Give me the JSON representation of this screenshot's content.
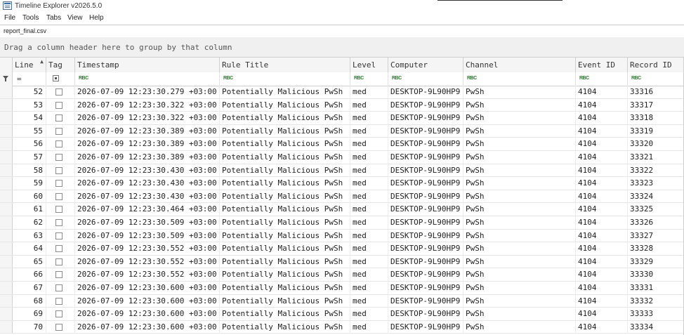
{
  "window": {
    "title": "Timeline Explorer v2026.5.0"
  },
  "menu": {
    "items": [
      "File",
      "Tools",
      "Tabs",
      "View",
      "Help"
    ]
  },
  "file_tab": {
    "label": "report_final.csv"
  },
  "group_panel": {
    "hint": "Drag a column header here to group by that column"
  },
  "columns": [
    {
      "key": "line",
      "label": "Line"
    },
    {
      "key": "tag",
      "label": "Tag"
    },
    {
      "key": "timestamp",
      "label": "Timestamp"
    },
    {
      "key": "rule_title",
      "label": "Rule Title"
    },
    {
      "key": "level",
      "label": "Level"
    },
    {
      "key": "computer",
      "label": "Computer"
    },
    {
      "key": "channel",
      "label": "Channel"
    },
    {
      "key": "event_id",
      "label": "Event ID"
    },
    {
      "key": "record_id",
      "label": "Record ID"
    }
  ],
  "filter_row": {
    "line_operator": "=",
    "text_filter_icon": "RBC"
  },
  "rows": [
    {
      "line": "52",
      "timestamp": "2026-07-09 12:23:30.279 +03:00",
      "rule_title": "Potentially Malicious PwSh",
      "level": "med",
      "computer": "DESKTOP-9L90HP9",
      "channel": "PwSh",
      "event_id": "4104",
      "record_id": "33316"
    },
    {
      "line": "53",
      "timestamp": "2026-07-09 12:23:30.322 +03:00",
      "rule_title": "Potentially Malicious PwSh",
      "level": "med",
      "computer": "DESKTOP-9L90HP9",
      "channel": "PwSh",
      "event_id": "4104",
      "record_id": "33317"
    },
    {
      "line": "54",
      "timestamp": "2026-07-09 12:23:30.322 +03:00",
      "rule_title": "Potentially Malicious PwSh",
      "level": "med",
      "computer": "DESKTOP-9L90HP9",
      "channel": "PwSh",
      "event_id": "4104",
      "record_id": "33318"
    },
    {
      "line": "55",
      "timestamp": "2026-07-09 12:23:30.389 +03:00",
      "rule_title": "Potentially Malicious PwSh",
      "level": "med",
      "computer": "DESKTOP-9L90HP9",
      "channel": "PwSh",
      "event_id": "4104",
      "record_id": "33319"
    },
    {
      "line": "56",
      "timestamp": "2026-07-09 12:23:30.389 +03:00",
      "rule_title": "Potentially Malicious PwSh",
      "level": "med",
      "computer": "DESKTOP-9L90HP9",
      "channel": "PwSh",
      "event_id": "4104",
      "record_id": "33320"
    },
    {
      "line": "57",
      "timestamp": "2026-07-09 12:23:30.389 +03:00",
      "rule_title": "Potentially Malicious PwSh",
      "level": "med",
      "computer": "DESKTOP-9L90HP9",
      "channel": "PwSh",
      "event_id": "4104",
      "record_id": "33321"
    },
    {
      "line": "58",
      "timestamp": "2026-07-09 12:23:30.430 +03:00",
      "rule_title": "Potentially Malicious PwSh",
      "level": "med",
      "computer": "DESKTOP-9L90HP9",
      "channel": "PwSh",
      "event_id": "4104",
      "record_id": "33322"
    },
    {
      "line": "59",
      "timestamp": "2026-07-09 12:23:30.430 +03:00",
      "rule_title": "Potentially Malicious PwSh",
      "level": "med",
      "computer": "DESKTOP-9L90HP9",
      "channel": "PwSh",
      "event_id": "4104",
      "record_id": "33323"
    },
    {
      "line": "60",
      "timestamp": "2026-07-09 12:23:30.430 +03:00",
      "rule_title": "Potentially Malicious PwSh",
      "level": "med",
      "computer": "DESKTOP-9L90HP9",
      "channel": "PwSh",
      "event_id": "4104",
      "record_id": "33324"
    },
    {
      "line": "61",
      "timestamp": "2026-07-09 12:23:30.464 +03:00",
      "rule_title": "Potentially Malicious PwSh",
      "level": "med",
      "computer": "DESKTOP-9L90HP9",
      "channel": "PwSh",
      "event_id": "4104",
      "record_id": "33325"
    },
    {
      "line": "62",
      "timestamp": "2026-07-09 12:23:30.509 +03:00",
      "rule_title": "Potentially Malicious PwSh",
      "level": "med",
      "computer": "DESKTOP-9L90HP9",
      "channel": "PwSh",
      "event_id": "4104",
      "record_id": "33326"
    },
    {
      "line": "63",
      "timestamp": "2026-07-09 12:23:30.509 +03:00",
      "rule_title": "Potentially Malicious PwSh",
      "level": "med",
      "computer": "DESKTOP-9L90HP9",
      "channel": "PwSh",
      "event_id": "4104",
      "record_id": "33327"
    },
    {
      "line": "64",
      "timestamp": "2026-07-09 12:23:30.552 +03:00",
      "rule_title": "Potentially Malicious PwSh",
      "level": "med",
      "computer": "DESKTOP-9L90HP9",
      "channel": "PwSh",
      "event_id": "4104",
      "record_id": "33328"
    },
    {
      "line": "65",
      "timestamp": "2026-07-09 12:23:30.552 +03:00",
      "rule_title": "Potentially Malicious PwSh",
      "level": "med",
      "computer": "DESKTOP-9L90HP9",
      "channel": "PwSh",
      "event_id": "4104",
      "record_id": "33329"
    },
    {
      "line": "66",
      "timestamp": "2026-07-09 12:23:30.552 +03:00",
      "rule_title": "Potentially Malicious PwSh",
      "level": "med",
      "computer": "DESKTOP-9L90HP9",
      "channel": "PwSh",
      "event_id": "4104",
      "record_id": "33330"
    },
    {
      "line": "67",
      "timestamp": "2026-07-09 12:23:30.600 +03:00",
      "rule_title": "Potentially Malicious PwSh",
      "level": "med",
      "computer": "DESKTOP-9L90HP9",
      "channel": "PwSh",
      "event_id": "4104",
      "record_id": "33331"
    },
    {
      "line": "68",
      "timestamp": "2026-07-09 12:23:30.600 +03:00",
      "rule_title": "Potentially Malicious PwSh",
      "level": "med",
      "computer": "DESKTOP-9L90HP9",
      "channel": "PwSh",
      "event_id": "4104",
      "record_id": "33332"
    },
    {
      "line": "69",
      "timestamp": "2026-07-09 12:23:30.600 +03:00",
      "rule_title": "Potentially Malicious PwSh",
      "level": "med",
      "computer": "DESKTOP-9L90HP9",
      "channel": "PwSh",
      "event_id": "4104",
      "record_id": "33333"
    },
    {
      "line": "70",
      "timestamp": "2026-07-09 12:23:30.600 +03:00",
      "rule_title": "Potentially Malicious PwSh",
      "level": "med",
      "computer": "DESKTOP-9L90HP9",
      "channel": "PwSh",
      "event_id": "4104",
      "record_id": "33334"
    }
  ]
}
